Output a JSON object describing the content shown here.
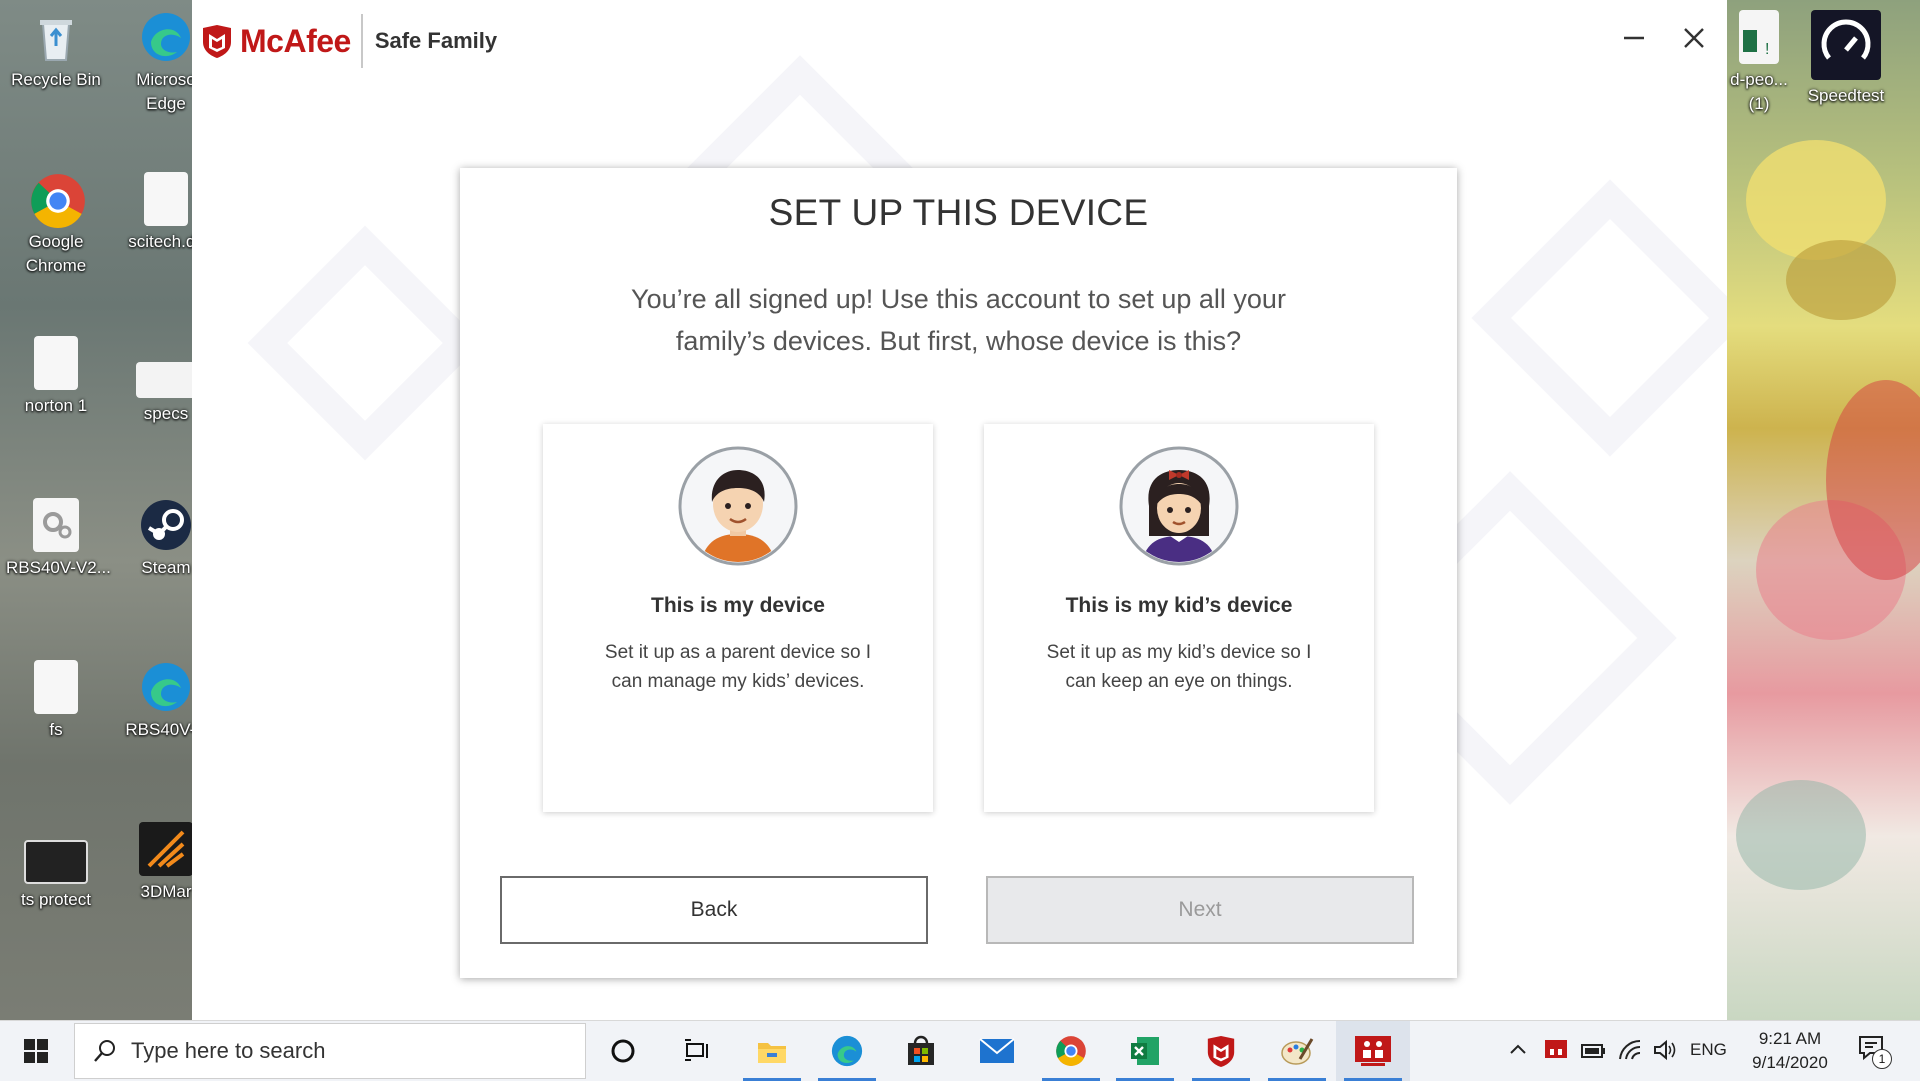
{
  "desktop": {
    "icons": [
      {
        "label": "Recycle Bin",
        "icon": "recycle-bin-icon"
      },
      {
        "label": "Microso",
        "label2": "Edge",
        "icon": "edge-icon"
      },
      {
        "label": "Google",
        "label2": "Chrome",
        "icon": "chrome-icon"
      },
      {
        "label": "scitech.dy",
        "icon": "file-icon"
      },
      {
        "label": "norton 1",
        "icon": "file-icon"
      },
      {
        "label": "specs",
        "icon": "file-icon"
      },
      {
        "label": "RBS40V-V2...",
        "icon": "settings-file-icon"
      },
      {
        "label": "Steam",
        "icon": "steam-icon"
      },
      {
        "label": "fs",
        "icon": "file-icon"
      },
      {
        "label": "RBS40V-V",
        "icon": "edge-icon"
      },
      {
        "label": "ts protect",
        "icon": "app-icon"
      },
      {
        "label": "3DMar",
        "icon": "3dmark-icon"
      },
      {
        "label": "d-peo...",
        "label2": "(1)",
        "icon": "excel-file-icon"
      },
      {
        "label": "Speedtest",
        "icon": "speedtest-icon"
      }
    ]
  },
  "app": {
    "brand_name": "McAfee",
    "product_name": "Safe Family",
    "controls": {
      "minimize": "minimize-icon",
      "close": "close-icon"
    }
  },
  "setup": {
    "title": "SET UP THIS DEVICE",
    "subtitle": "You’re all signed up! Use this account to set up all your family’s devices. But first, whose device is this?",
    "options": [
      {
        "title": "This is my device",
        "description": "Set it up as a parent device so I can manage my kids’ devices.",
        "avatar": "parent-avatar-icon"
      },
      {
        "title": "This is my kid’s device",
        "description": "Set it up as my kid’s device so I can keep an eye on things.",
        "avatar": "kid-avatar-icon"
      }
    ],
    "back_label": "Back",
    "next_label": "Next"
  },
  "taskbar": {
    "search_placeholder": "Type here to search",
    "pinned": [
      "cortana-icon",
      "task-view-icon",
      "file-explorer-icon",
      "edge-icon",
      "store-icon",
      "mail-icon",
      "chrome-icon",
      "excel-icon",
      "mcafee-icon",
      "paint-icon",
      "safe-family-icon"
    ],
    "language": "ENG",
    "time": "9:21 AM",
    "date": "9/14/2020",
    "notification_count": "1"
  },
  "colors": {
    "brand_red": "#c01818",
    "taskbar_bg": "#f1f3f7",
    "accent_blue": "#3a7fd5",
    "next_disabled_bg": "#e8e9eb"
  }
}
